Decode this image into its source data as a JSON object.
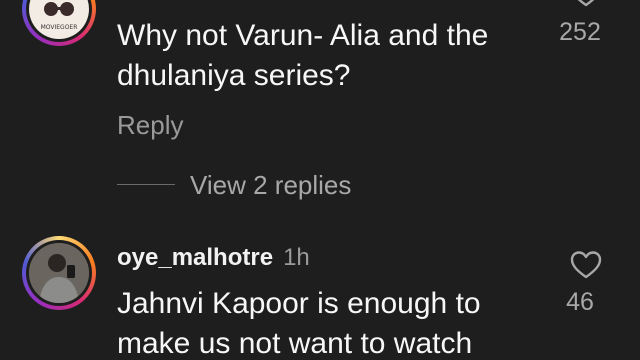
{
  "comments": [
    {
      "username": "",
      "avatar_label": "MOVIEGOER",
      "text_lines": [
        "Why not Varun- Alia and the",
        "dhulaniya series?"
      ],
      "like_count": "252",
      "reply_label": "Reply",
      "view_replies_label": "View 2 replies"
    },
    {
      "username": "oye_malhotre",
      "timestamp": "1h",
      "text_lines": [
        "Jahnvi Kapoor is enough to",
        "make us not want to watch"
      ],
      "like_count": "46"
    }
  ],
  "colors": {
    "background": "#1e1e1e",
    "primary_text": "#f5f5f5",
    "secondary_text": "#9a9a9a",
    "story_ring": [
      "#feda75",
      "#fa7e1e",
      "#d62976",
      "#962fbf",
      "#4f5bd5"
    ]
  },
  "icons": [
    "heart-outline-icon"
  ]
}
